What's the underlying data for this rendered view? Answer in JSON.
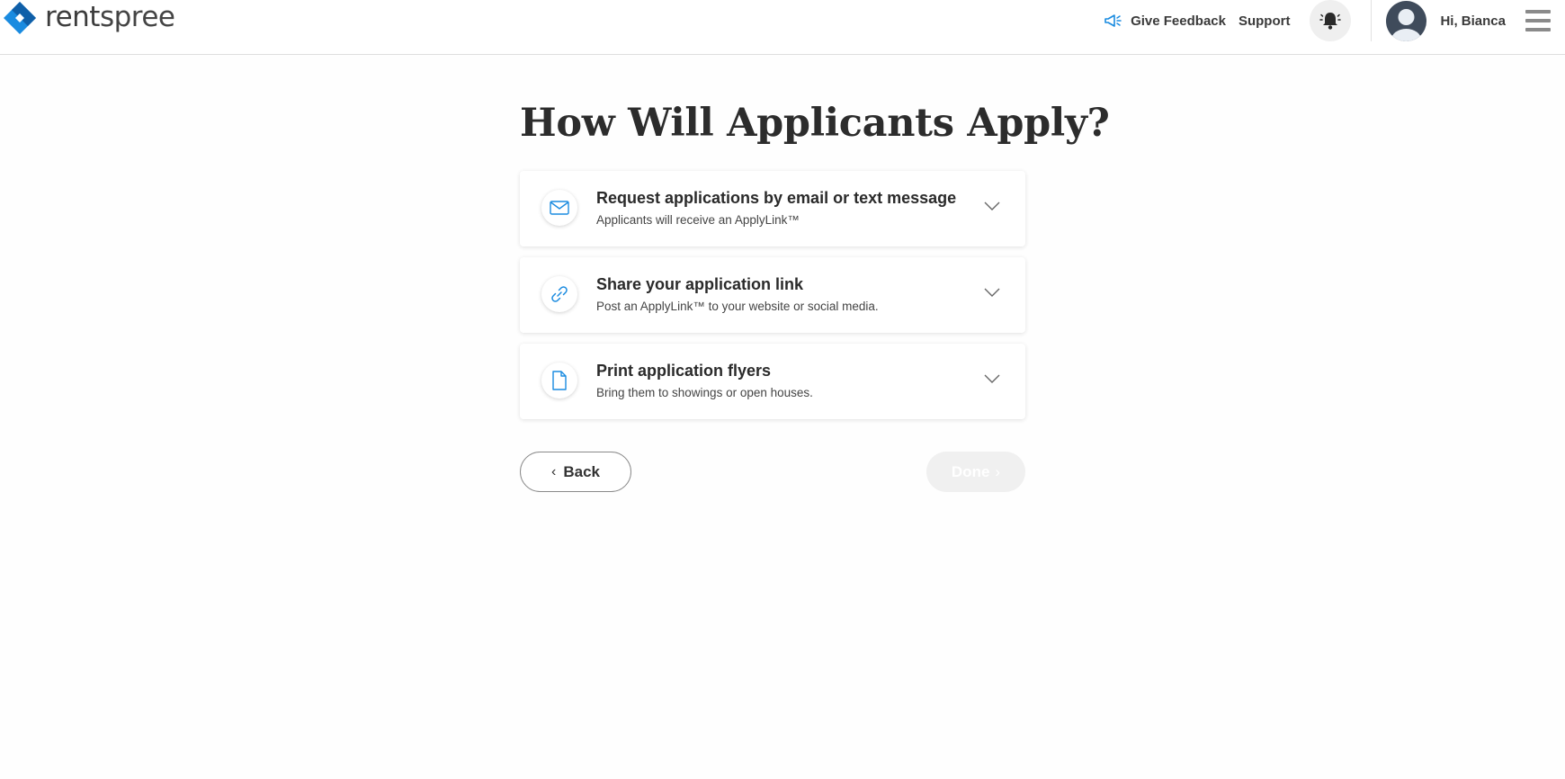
{
  "brand": {
    "logo_bold": "rent",
    "logo_light": "spree",
    "colors": {
      "primary": "#1a8be0",
      "dark": "#0f5fa8"
    }
  },
  "header": {
    "feedback_label": "Give Feedback",
    "feedback_icon": "megaphone-icon",
    "support_label": "Support",
    "notification_icon": "bell-icon",
    "greeting": "Hi, Bianca",
    "menu_icon": "hamburger-menu-icon"
  },
  "page": {
    "title": "How Will Applicants Apply?"
  },
  "options": [
    {
      "icon": "envelope-icon",
      "title": "Request applications by email or text message",
      "subtitle": "Applicants will receive an ApplyLink™"
    },
    {
      "icon": "link-icon",
      "title": "Share your application link",
      "subtitle": "Post an ApplyLink™ to your website or social media."
    },
    {
      "icon": "document-icon",
      "title": "Print application flyers",
      "subtitle": "Bring them to showings or open houses."
    }
  ],
  "footer": {
    "back_label": "Back",
    "done_label": "Done"
  }
}
